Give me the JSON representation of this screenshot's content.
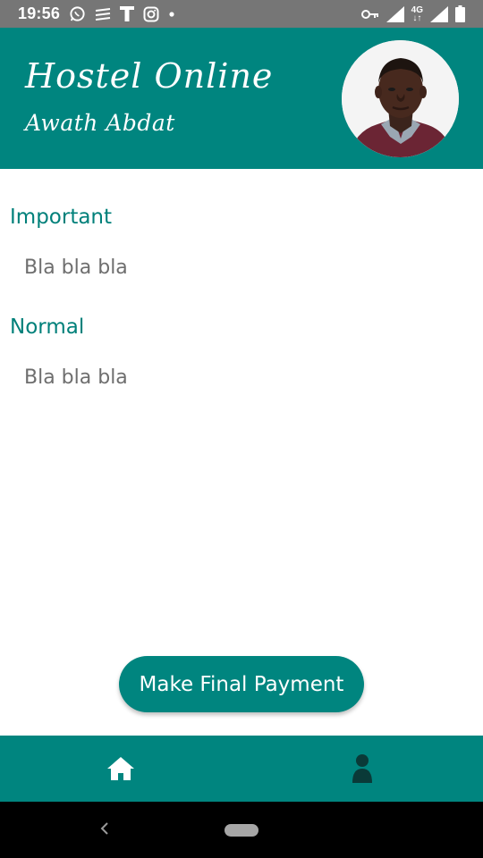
{
  "status_bar": {
    "time": "19:56",
    "network_label_top": "4G",
    "network_label_bottom": "↓↑",
    "icons_left": [
      "whatsapp-icon",
      "equalizer-icon",
      "t-icon",
      "instagram-icon",
      "dot-icon"
    ],
    "icons_right": [
      "key-icon",
      "signal-icon",
      "signal-icon",
      "battery-icon"
    ]
  },
  "header": {
    "app_title": "Hostel Online",
    "user_name": "Awath Abdat",
    "avatar_icon": "user-photo"
  },
  "sections": [
    {
      "title": "Important",
      "body": "Bla bla bla"
    },
    {
      "title": "Normal",
      "body": "Bla bla bla"
    }
  ],
  "payment_button": {
    "label": "Make Final Payment"
  },
  "bottom_nav": {
    "items": [
      {
        "icon": "home-icon"
      },
      {
        "icon": "profile-icon"
      }
    ]
  },
  "colors": {
    "primary": "#00857f",
    "section_title": "#00807a",
    "body_text": "#6e6e6e",
    "status_bar": "#767676"
  }
}
